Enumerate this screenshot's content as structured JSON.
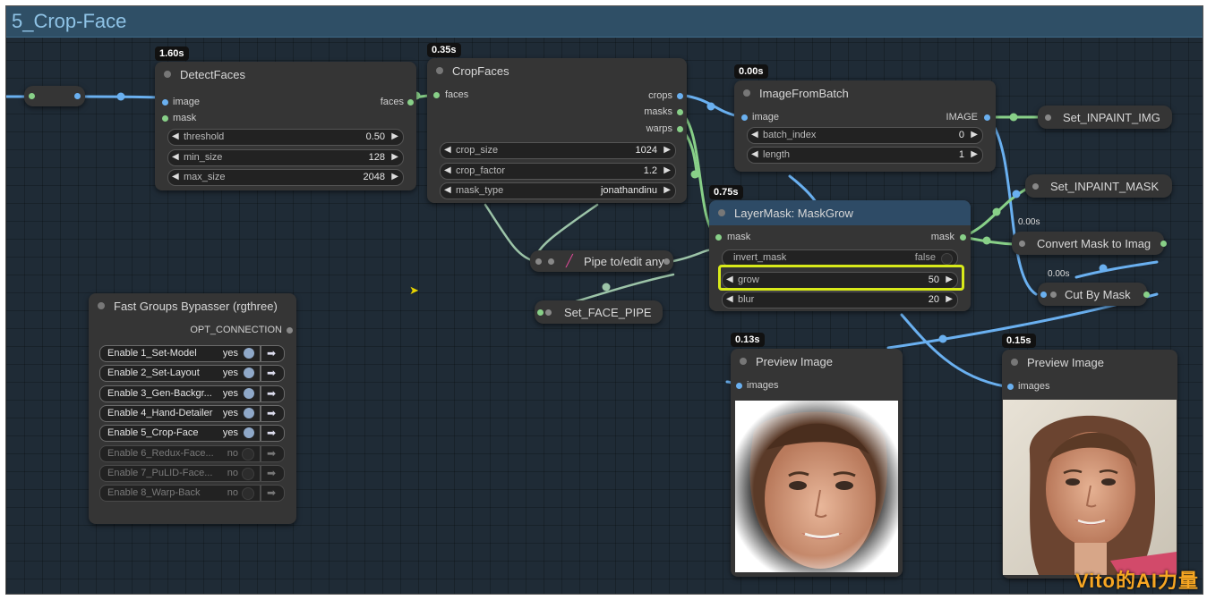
{
  "group": {
    "title": "5_Crop-Face"
  },
  "nodes": {
    "detect_faces": {
      "time": "1.60s",
      "title": "DetectFaces",
      "inputs": [
        "image",
        "mask"
      ],
      "outputs": [
        "faces"
      ],
      "widgets": [
        {
          "name": "threshold",
          "value": "0.50"
        },
        {
          "name": "min_size",
          "value": "128"
        },
        {
          "name": "max_size",
          "value": "2048"
        }
      ]
    },
    "crop_faces": {
      "time": "0.35s",
      "title": "CropFaces",
      "inputs": [
        "faces"
      ],
      "outputs": [
        "crops",
        "masks",
        "warps"
      ],
      "widgets": [
        {
          "name": "crop_size",
          "value": "1024"
        },
        {
          "name": "crop_factor",
          "value": "1.2"
        },
        {
          "name": "mask_type",
          "value": "jonathandinu"
        }
      ]
    },
    "image_from_batch": {
      "time": "0.00s",
      "title": "ImageFromBatch",
      "inputs": [
        "image"
      ],
      "outputs": [
        "IMAGE"
      ],
      "widgets": [
        {
          "name": "batch_index",
          "value": "0"
        },
        {
          "name": "length",
          "value": "1"
        }
      ]
    },
    "mask_grow": {
      "time": "0.75s",
      "title": "LayerMask: MaskGrow",
      "inputs": [
        "mask"
      ],
      "outputs": [
        "mask"
      ],
      "toggle": {
        "name": "invert_mask",
        "value": "false"
      },
      "widgets": [
        {
          "name": "grow",
          "value": "50"
        },
        {
          "name": "blur",
          "value": "20"
        }
      ]
    },
    "set_inpaint_img": {
      "title": "Set_INPAINT_IMG"
    },
    "set_inpaint_mask": {
      "title": "Set_INPAINT_MASK"
    },
    "convert_mask": {
      "time": "0.00s",
      "title": "Convert Mask to Imag"
    },
    "cut_by_mask": {
      "time": "0.00s",
      "title": "Cut By Mask"
    },
    "pipe_edit": {
      "title": "Pipe to/edit any"
    },
    "set_face_pipe": {
      "title": "Set_FACE_PIPE"
    },
    "preview1": {
      "time": "0.13s",
      "title": "Preview Image",
      "input": "images"
    },
    "preview2": {
      "time": "0.15s",
      "title": "Preview Image",
      "input": "images"
    },
    "bypasser": {
      "title": "Fast Groups Bypasser (rgthree)",
      "output": "OPT_CONNECTION",
      "rows": [
        {
          "label": "Enable 1_Set-Model",
          "state": "yes",
          "on": true
        },
        {
          "label": "Enable 2_Set-Layout",
          "state": "yes",
          "on": true
        },
        {
          "label": "Enable 3_Gen-Backgr...",
          "state": "yes",
          "on": true
        },
        {
          "label": "Enable 4_Hand-Detailer",
          "state": "yes",
          "on": true
        },
        {
          "label": "Enable 5_Crop-Face",
          "state": "yes",
          "on": true
        },
        {
          "label": "Enable 6_Redux-Face...",
          "state": "no",
          "on": false
        },
        {
          "label": "Enable 7_PuLID-Face...",
          "state": "no",
          "on": false
        },
        {
          "label": "Enable 8_Warp-Back",
          "state": "no",
          "on": false
        }
      ]
    }
  },
  "watermark": "Vito的AI力量",
  "colors": {
    "canvas": "#1f2b36",
    "node": "#353535",
    "header_blue": "#2e4b66",
    "wire_blue": "#6ab0f0",
    "wire_green": "#88d088",
    "highlight": "#d8ea1a",
    "watermark": "#f6a623"
  },
  "icons": [
    "node-status-dot",
    "arrow-left-icon",
    "arrow-right-icon",
    "toggle-knob",
    "pipe-edit-icon",
    "group-nav-arrow-icon",
    "mouse-cursor-icon"
  ]
}
